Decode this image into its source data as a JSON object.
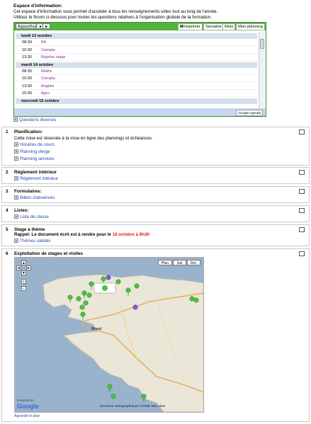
{
  "info": {
    "title": "Espace d'information:",
    "line1": "Cet espace d'information vous permet d'accéder à tous les renseignements utiles tout au long de l'année.",
    "line2": "Utilisez le forum ci-dessous pour toutes les questions relatives à l'organisation globale de la formation.",
    "forum_link": "Questions diverses"
  },
  "calendar": {
    "today_button": "Aujourd'hui",
    "nav_prev": "◄",
    "nav_next": "►",
    "print_label": "Imprimer",
    "tabs": [
      "Semaine",
      "Mois",
      "Mon planning"
    ],
    "footer_badge": "Google Agenda",
    "days": [
      {
        "label": "lundi 13 octobre",
        "events": [
          {
            "time": "08:30",
            "name": "PA"
          },
          {
            "time": "10:30",
            "name": "Compta"
          },
          {
            "time": "13:30",
            "name": "Reprise stage"
          }
        ]
      },
      {
        "label": "mardi 14 octobre",
        "events": [
          {
            "time": "08:30",
            "name": "Maths"
          },
          {
            "time": "10:30",
            "name": "Compta"
          },
          {
            "time": "13:30",
            "name": "Anglais"
          },
          {
            "time": "15:30",
            "name": "Agro"
          }
        ]
      },
      {
        "label": "mercredi 15 octobre",
        "events": []
      }
    ]
  },
  "sections": {
    "s1": {
      "num": "1",
      "title": "Planification:",
      "desc": "Cette zone est réservée à la mise en ligne des plannings et échéances.",
      "links": [
        "Horaires de cours",
        "Planning vierge",
        "Planning services"
      ]
    },
    "s2": {
      "num": "2",
      "title": "Règlement intérieur",
      "link": "Règlement intérieur"
    },
    "s3": {
      "num": "3",
      "title": "Formulaires:",
      "link": "Billets d'absences"
    },
    "s4": {
      "num": "4",
      "title": "Listes:",
      "link": "Liste de classe"
    },
    "s5": {
      "num": "5",
      "title": "Stage à thème",
      "rappel_prefix": "Rappel: Le document écrit est à rendre pour le ",
      "rappel_date": "16 octobre à 8h30",
      "link": "Thèmes validés"
    },
    "s6": {
      "num": "6",
      "title": "Exploitation de stages et visites",
      "map_buttons": [
        "Plan",
        "Sat",
        "Rel."
      ],
      "city": "Brest",
      "copyright": "Données cartographiques ©2008 Tele Atlas",
      "google": "Google",
      "powered": "POWERED BY",
      "enlarge": "Agrandir le plan"
    }
  },
  "colors": {
    "accent": "#55b33d",
    "date_red": "#e0201a",
    "link": "#2547b8",
    "event": "#8a2e8a"
  }
}
